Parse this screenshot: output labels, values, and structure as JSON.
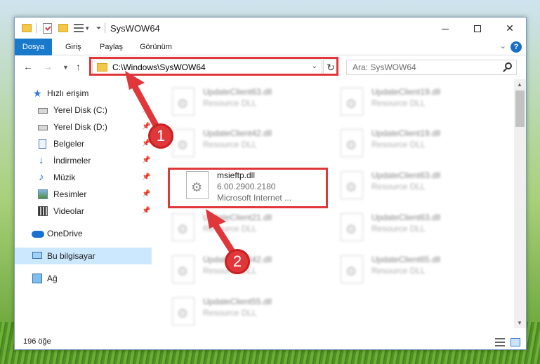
{
  "window": {
    "title": "SysWOW64"
  },
  "ribbon": {
    "tabs": [
      "Dosya",
      "Giriş",
      "Paylaş",
      "Görünüm"
    ]
  },
  "address": {
    "path": "C:\\Windows\\SysWOW64",
    "search_placeholder": "Ara: SysWOW64"
  },
  "nav": {
    "items": [
      {
        "label": "Hızlı erişim",
        "icon": "star-icon"
      },
      {
        "label": "Yerel Disk (C:)",
        "icon": "disk-icon"
      },
      {
        "label": "Yerel Disk (D:)",
        "icon": "disk-icon"
      },
      {
        "label": "Belgeler",
        "icon": "documents-icon"
      },
      {
        "label": "İndirmeler",
        "icon": "downloads-icon"
      },
      {
        "label": "Müzik",
        "icon": "music-icon"
      },
      {
        "label": "Resimler",
        "icon": "pictures-icon"
      },
      {
        "label": "Videolar",
        "icon": "videos-icon"
      },
      {
        "label": "OneDrive",
        "icon": "cloud-icon"
      },
      {
        "label": "Bu bilgisayar",
        "icon": "computer-icon"
      },
      {
        "label": "Ağ",
        "icon": "network-icon"
      }
    ]
  },
  "files": {
    "tiles": [
      {
        "name": "UpdateClient63.dll",
        "sub1": "Resource DLL",
        "sub2": ""
      },
      {
        "name": "UpdateClient19.dll",
        "sub1": "Resource DLL",
        "sub2": ""
      },
      {
        "name": "UpdateClient42.dll",
        "sub1": "Resource DLL",
        "sub2": ""
      },
      {
        "name": "UpdateClient19.dll",
        "sub1": "Resource DLL",
        "sub2": ""
      },
      {
        "name": "msieftp.dll",
        "sub1": "6.00.2900.2180",
        "sub2": "Microsoft Internet ..."
      },
      {
        "name": "UpdateClient63.dll",
        "sub1": "Resource DLL",
        "sub2": ""
      },
      {
        "name": "UpdateClient21.dll",
        "sub1": "Resource DLL",
        "sub2": ""
      },
      {
        "name": "UpdateClient63.dll",
        "sub1": "Resource DLL",
        "sub2": ""
      },
      {
        "name": "UpdateClient42.dll",
        "sub1": "Resource DLL",
        "sub2": ""
      },
      {
        "name": "UpdateClient65.dll",
        "sub1": "Resource DLL",
        "sub2": ""
      },
      {
        "name": "UpdateClient55.dll",
        "sub1": "Resource DLL",
        "sub2": ""
      }
    ]
  },
  "status": {
    "count": "196 öğe"
  },
  "annotations": {
    "step1": "1",
    "step2": "2",
    "color": "#e0373a"
  }
}
